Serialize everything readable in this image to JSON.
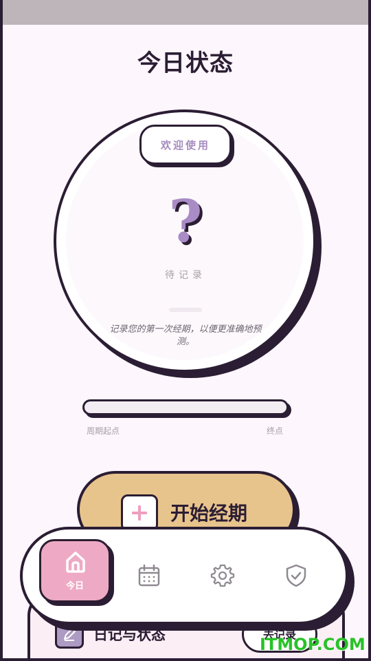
{
  "page": {
    "title": "今日状态"
  },
  "status_circle": {
    "welcome_badge": "欢迎使用",
    "symbol": "?",
    "status_text": "待记录",
    "hint": "记录您的第一次经期，以便更准确地预测。"
  },
  "cycle_bar": {
    "start_label": "周期起点",
    "end_label": "终点",
    "progress": 0
  },
  "start_button": {
    "label": "开始经期",
    "icon": "plus-icon"
  },
  "diary_card": {
    "title": "日记与状态",
    "button_label": "去记录",
    "icon": "pencil-icon"
  },
  "bottom_nav": {
    "items": [
      {
        "label": "今日",
        "icon": "home-icon",
        "active": true
      },
      {
        "label": "",
        "icon": "calendar-icon",
        "active": false
      },
      {
        "label": "",
        "icon": "gear-icon",
        "active": false
      },
      {
        "label": "",
        "icon": "shield-check-icon",
        "active": false
      }
    ]
  },
  "watermark": "ITMOP.COM",
  "colors": {
    "background": "#fdf6fd",
    "outline": "#2b1d33",
    "accent_pink": "#eeaac4",
    "accent_gold": "#e8c48d",
    "accent_purple": "#a98bc6"
  }
}
